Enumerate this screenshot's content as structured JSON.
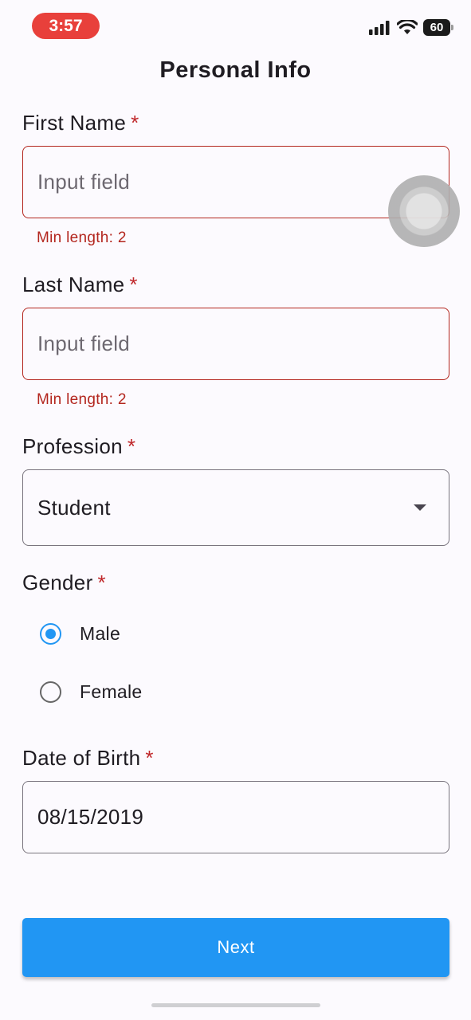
{
  "status_bar": {
    "time": "3:57",
    "battery": "60"
  },
  "page": {
    "title": "Personal Info"
  },
  "form": {
    "required_mark": "*",
    "first_name": {
      "label": "First Name",
      "placeholder": "Input field",
      "error": "Min length: 2"
    },
    "last_name": {
      "label": "Last Name",
      "placeholder": "Input field",
      "error": "Min length: 2"
    },
    "profession": {
      "label": "Profession",
      "value": "Student"
    },
    "gender": {
      "label": "Gender",
      "options": [
        {
          "label": "Male",
          "selected": true
        },
        {
          "label": "Female",
          "selected": false
        }
      ]
    },
    "date_of_birth": {
      "label": "Date of Birth",
      "value": "08/15/2019"
    }
  },
  "actions": {
    "next_label": "Next"
  },
  "colors": {
    "accent": "#2196f3",
    "error": "#b3261e",
    "status_time_bg": "#e8403b"
  },
  "icons": [
    "signal-icon",
    "wifi-icon",
    "battery-icon",
    "dropdown-arrow-icon"
  ]
}
